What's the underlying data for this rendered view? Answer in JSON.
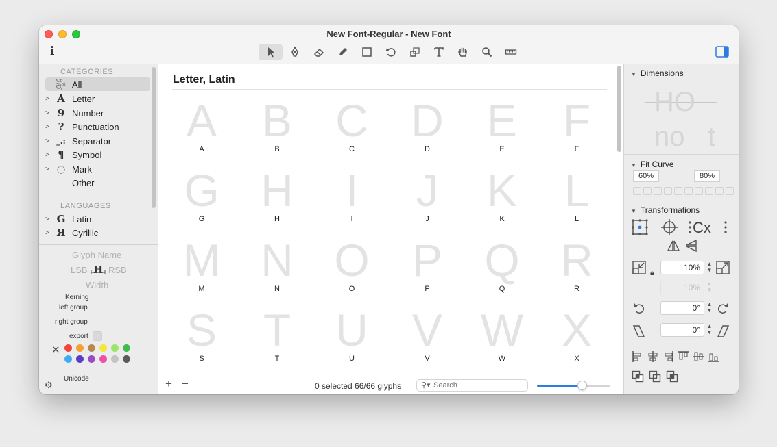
{
  "window": {
    "title": "New Font-Regular - New Font",
    "info_label": "i"
  },
  "toolbar": {
    "tools": [
      {
        "name": "select-tool",
        "icon": "arrow-pointer-icon"
      },
      {
        "name": "pen-tool",
        "icon": "pen-nib-icon"
      },
      {
        "name": "eraser-tool",
        "icon": "eraser-icon"
      },
      {
        "name": "pencil-tool",
        "icon": "pencil-icon"
      },
      {
        "name": "rectangle-tool",
        "icon": "rectangle-icon"
      },
      {
        "name": "rotate-tool",
        "icon": "rotate-icon"
      },
      {
        "name": "scale-tool",
        "icon": "scale-icon"
      },
      {
        "name": "text-tool",
        "icon": "text-t-icon"
      },
      {
        "name": "hand-tool",
        "icon": "hand-icon"
      },
      {
        "name": "zoom-tool",
        "icon": "magnifier-icon"
      },
      {
        "name": "measure-tool",
        "icon": "ruler-icon"
      }
    ]
  },
  "sidebar": {
    "categories_heading": "CATEGORIES",
    "categories": [
      {
        "label": "All",
        "glyph": "",
        "selected": true
      },
      {
        "label": "Letter",
        "glyph": "A"
      },
      {
        "label": "Number",
        "glyph": "9"
      },
      {
        "label": "Punctuation",
        "glyph": "?"
      },
      {
        "label": "Separator",
        "glyph": "_.:"
      },
      {
        "label": "Symbol",
        "glyph": "¶"
      },
      {
        "label": "Mark",
        "glyph": "◌"
      },
      {
        "label": "Other",
        "glyph": ""
      }
    ],
    "languages_heading": "LANGUAGES",
    "languages": [
      {
        "label": "Latin",
        "glyph": "G"
      },
      {
        "label": "Cyrillic",
        "glyph": "Я"
      }
    ]
  },
  "glyph_info": {
    "glyph_name_placeholder": "Glyph Name",
    "lsb_placeholder": "LSB",
    "rsb_placeholder": "RSB",
    "width_placeholder": "Width",
    "kerning_label": "Kerning",
    "left_group_label": "left group",
    "right_group_label": "right group",
    "export_label": "export",
    "unicode_label": "Unicode",
    "colors": [
      "#f0463a",
      "#f5a02f",
      "#b8894f",
      "#f3e832",
      "#9ee36a",
      "#3fbd4b",
      "#3fa9f5",
      "#5b3cc4",
      "#9b4cc2",
      "#ee4fa8",
      "#c4c4c4",
      "#5a5a5a"
    ]
  },
  "main": {
    "title": "Letter, Latin",
    "glyphs": [
      "A",
      "B",
      "C",
      "D",
      "E",
      "F",
      "G",
      "H",
      "I",
      "J",
      "K",
      "L",
      "M",
      "N",
      "O",
      "P",
      "Q",
      "R",
      "S",
      "T",
      "U",
      "V",
      "W",
      "X"
    ],
    "status": "0 selected 66/66 glyphs",
    "search_placeholder": "Search",
    "add_label": "+",
    "remove_label": "−",
    "zoom_level": 0.62,
    "accent": "#2f7ce0"
  },
  "inspector": {
    "dimensions_label": "Dimensions",
    "dim_upper": "HO",
    "dim_lower_a": "no",
    "dim_lower_b": "t",
    "fit_curve_label": "Fit Curve",
    "fit_min": "60%",
    "fit_max": "80%",
    "transformations_label": "Transformations",
    "scale_value": "10%",
    "scale_value_2": "10%",
    "rotate_value": "0°",
    "slant_value": "0°"
  }
}
